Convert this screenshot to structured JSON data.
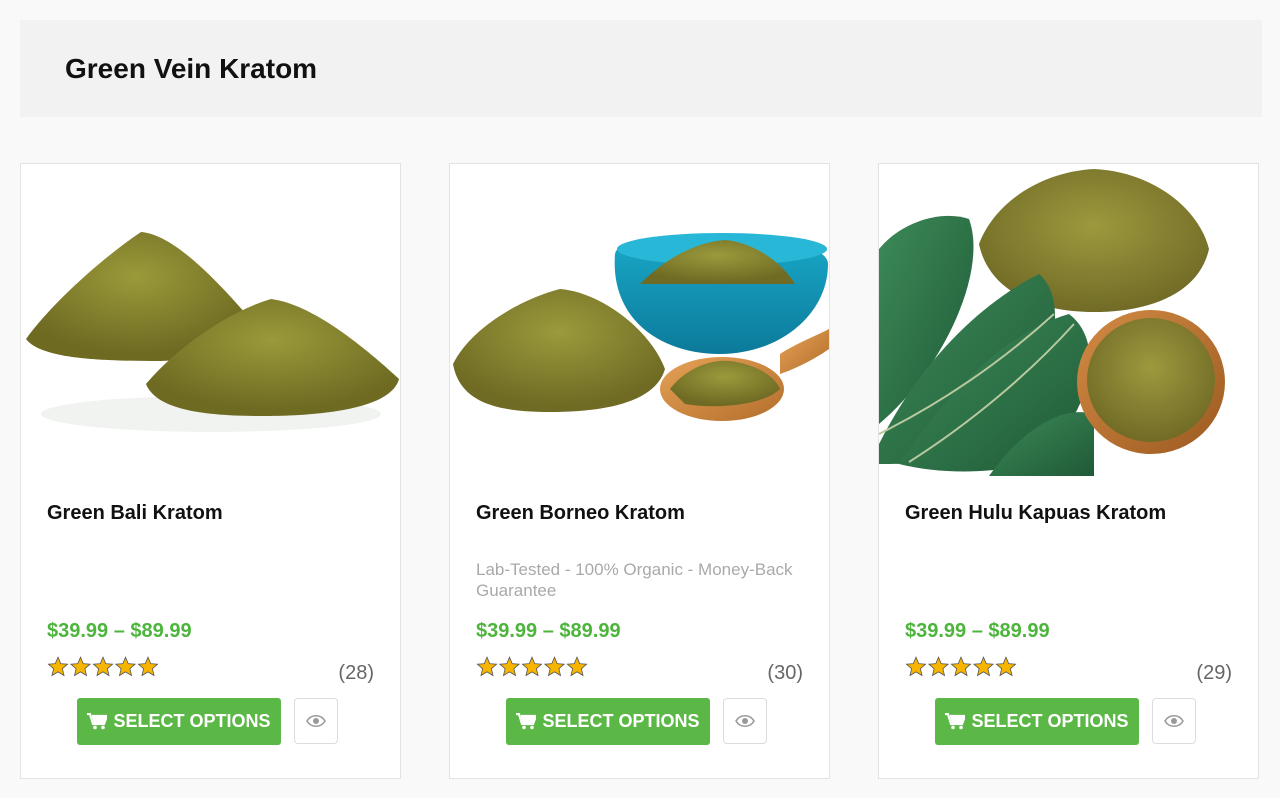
{
  "page": {
    "title": "Green Vein Kratom"
  },
  "products": [
    {
      "name": "Green Bali Kratom",
      "subtitle": "",
      "price": "$39.99 – $89.99",
      "rating": 5,
      "review_count": "(28)",
      "button_label": "SELECT OPTIONS"
    },
    {
      "name": "Green Borneo Kratom",
      "subtitle": "Lab-Tested - 100% Organic - Money-Back Guarantee",
      "price": "$39.99 – $89.99",
      "rating": 5,
      "review_count": "(30)",
      "button_label": "SELECT OPTIONS"
    },
    {
      "name": "Green Hulu Kapuas Kratom",
      "subtitle": "",
      "price": "$39.99 – $89.99",
      "rating": 5,
      "review_count": "(29)",
      "button_label": "SELECT OPTIONS"
    }
  ],
  "colors": {
    "accent_green": "#5cb846",
    "price_green": "#4db53c",
    "star_gold": "#f7b500"
  },
  "icons": {
    "cart": "cart-icon",
    "quick_view": "eye-icon",
    "star": "star-icon"
  }
}
